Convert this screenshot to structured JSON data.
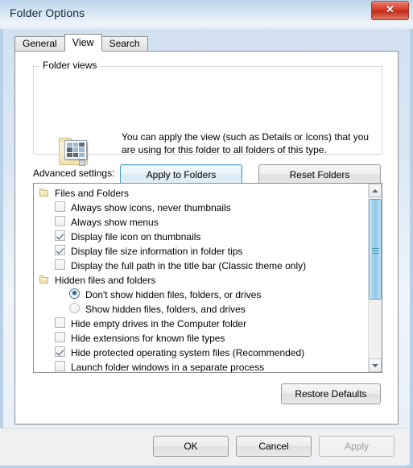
{
  "window": {
    "title": "Folder Options",
    "close_label": "✕"
  },
  "tabs": [
    {
      "label": "General",
      "active": false
    },
    {
      "label": "View",
      "active": true
    },
    {
      "label": "Search",
      "active": false
    }
  ],
  "folder_views": {
    "legend": "Folder views",
    "description": "You can apply the view (such as Details or Icons) that you are using for this folder to all folders of this type.",
    "apply_to_folders_label": "Apply to Folders",
    "reset_folders_label": "Reset Folders"
  },
  "advanced": {
    "label": "Advanced settings:",
    "rows": [
      {
        "type": "group",
        "label": "Files and Folders"
      },
      {
        "type": "checkbox",
        "label": "Always show icons, never thumbnails",
        "checked": false
      },
      {
        "type": "checkbox",
        "label": "Always show menus",
        "checked": false
      },
      {
        "type": "checkbox",
        "label": "Display file icon on thumbnails",
        "checked": true
      },
      {
        "type": "checkbox",
        "label": "Display file size information in folder tips",
        "checked": true
      },
      {
        "type": "checkbox",
        "label": "Display the full path in the title bar (Classic theme only)",
        "checked": false
      },
      {
        "type": "group",
        "label": "Hidden files and folders"
      },
      {
        "type": "radio",
        "label": "Don't show hidden files, folders, or drives",
        "selected": true
      },
      {
        "type": "radio",
        "label": "Show hidden files, folders, and drives",
        "selected": false
      },
      {
        "type": "checkbox",
        "label": "Hide empty drives in the Computer folder",
        "checked": false
      },
      {
        "type": "checkbox",
        "label": "Hide extensions for known file types",
        "checked": false
      },
      {
        "type": "checkbox",
        "label": "Hide protected operating system files (Recommended)",
        "checked": true
      },
      {
        "type": "checkbox",
        "label": "Launch folder windows in a separate process",
        "checked": false
      }
    ],
    "scrollbar": {
      "up_arrow": "▲",
      "down_arrow": "▼"
    }
  },
  "restore_defaults_label": "Restore Defaults",
  "footer": {
    "ok_label": "OK",
    "cancel_label": "Cancel",
    "apply_label": "Apply",
    "apply_enabled": false
  },
  "colors": {
    "title_accent": "#cbe0f1",
    "close_red": "#d9432f",
    "focus_border": "#4f9bbf",
    "scroll_thumb": "#8ecae8",
    "folder_yellow": "#efdfa6"
  }
}
